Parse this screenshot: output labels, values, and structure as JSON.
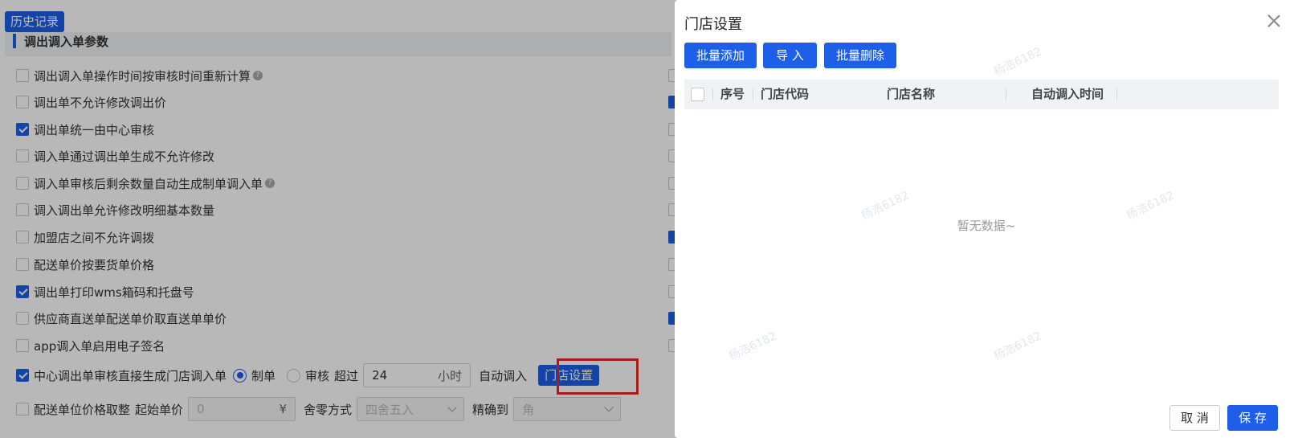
{
  "background": {
    "history_button": "历史记录",
    "section_title": "调出调入单参数",
    "options": [
      {
        "label": "调出调入单操作时间按审核时间重新计算",
        "checked": false,
        "help": true
      },
      {
        "label": "调出单不允许修改调出价",
        "checked": false,
        "help": false
      },
      {
        "label": "调出单统一由中心审核",
        "checked": true,
        "help": false
      },
      {
        "label": "调入单通过调出单生成不允许修改",
        "checked": false,
        "help": false
      },
      {
        "label": "调入单审核后剩余数量自动生成制单调入单",
        "checked": false,
        "help": true
      },
      {
        "label": "调入调出单允许修改明细基本数量",
        "checked": false,
        "help": false
      },
      {
        "label": "加盟店之间不允许调拨",
        "checked": false,
        "help": false
      },
      {
        "label": "配送单价按要货单价格",
        "checked": false,
        "help": false
      },
      {
        "label": "调出单打印wms箱码和托盘号",
        "checked": true,
        "help": false
      },
      {
        "label": "供应商直送单配送单价取直送单单价",
        "checked": false,
        "help": false
      },
      {
        "label": "app调入单启用电子签名",
        "checked": false,
        "help": false
      }
    ],
    "auto_row": {
      "label": "中心调出单审核直接生成门店调入单",
      "checked": true,
      "radio_draft": "制单",
      "radio_audit": "审核",
      "exceed_label": "超过",
      "hours_value": "24",
      "hours_suffix": "小时",
      "auto_in_label": "自动调入",
      "store_settings_button": "门店设置"
    },
    "price_row": {
      "label": "配送单位价格取整",
      "checked": false,
      "start_price_label": "起始单价",
      "start_price_value": "0",
      "currency": "¥",
      "rounding_label": "舍零方式",
      "rounding_value": "四舍五入",
      "precision_label": "精确到",
      "precision_value": "角"
    }
  },
  "modal": {
    "title": "门店设置",
    "toolbar": {
      "batch_add": "批量添加",
      "import": "导 入",
      "batch_delete": "批量删除"
    },
    "table": {
      "columns": [
        "序号",
        "门店代码",
        "门店名称",
        "自动调入时间"
      ],
      "rows": []
    },
    "empty_text": "暂无数据~",
    "watermark": "杨浩6182",
    "footer": {
      "cancel": "取 消",
      "save": "保 存"
    }
  },
  "colors": {
    "primary": "#1d5fe6",
    "highlight_frame": "#e52727"
  }
}
